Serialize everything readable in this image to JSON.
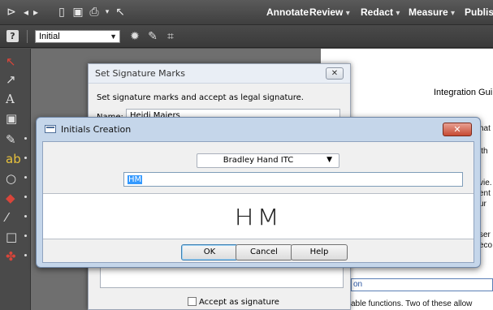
{
  "toolbar": {
    "menus": [
      "Annotate",
      "Review",
      "Redact",
      "Measure",
      "Publish"
    ]
  },
  "toolbar2": {
    "help_label": "?",
    "initial_select": "Initial"
  },
  "page": {
    "title": "Integration Gui",
    "fragments": [
      "hat",
      "ith",
      "vie.",
      "ent",
      "ur",
      "ser",
      "eco",
      "able functions. Two of these allow"
    ],
    "link_text": "on"
  },
  "sig_dialog": {
    "title": "Set Signature Marks",
    "instruction": "Set signature marks and accept as legal signature.",
    "name_label": "Name:",
    "name_value": "Heidi Maiers",
    "accept_label": "Accept as signature"
  },
  "initials_dialog": {
    "title": "Initials Creation",
    "font_value": "Bradley Hand ITC",
    "input_value": "HM",
    "preview_text": "HM",
    "buttons": {
      "ok": "OK",
      "cancel": "Cancel",
      "help": "Help"
    }
  }
}
